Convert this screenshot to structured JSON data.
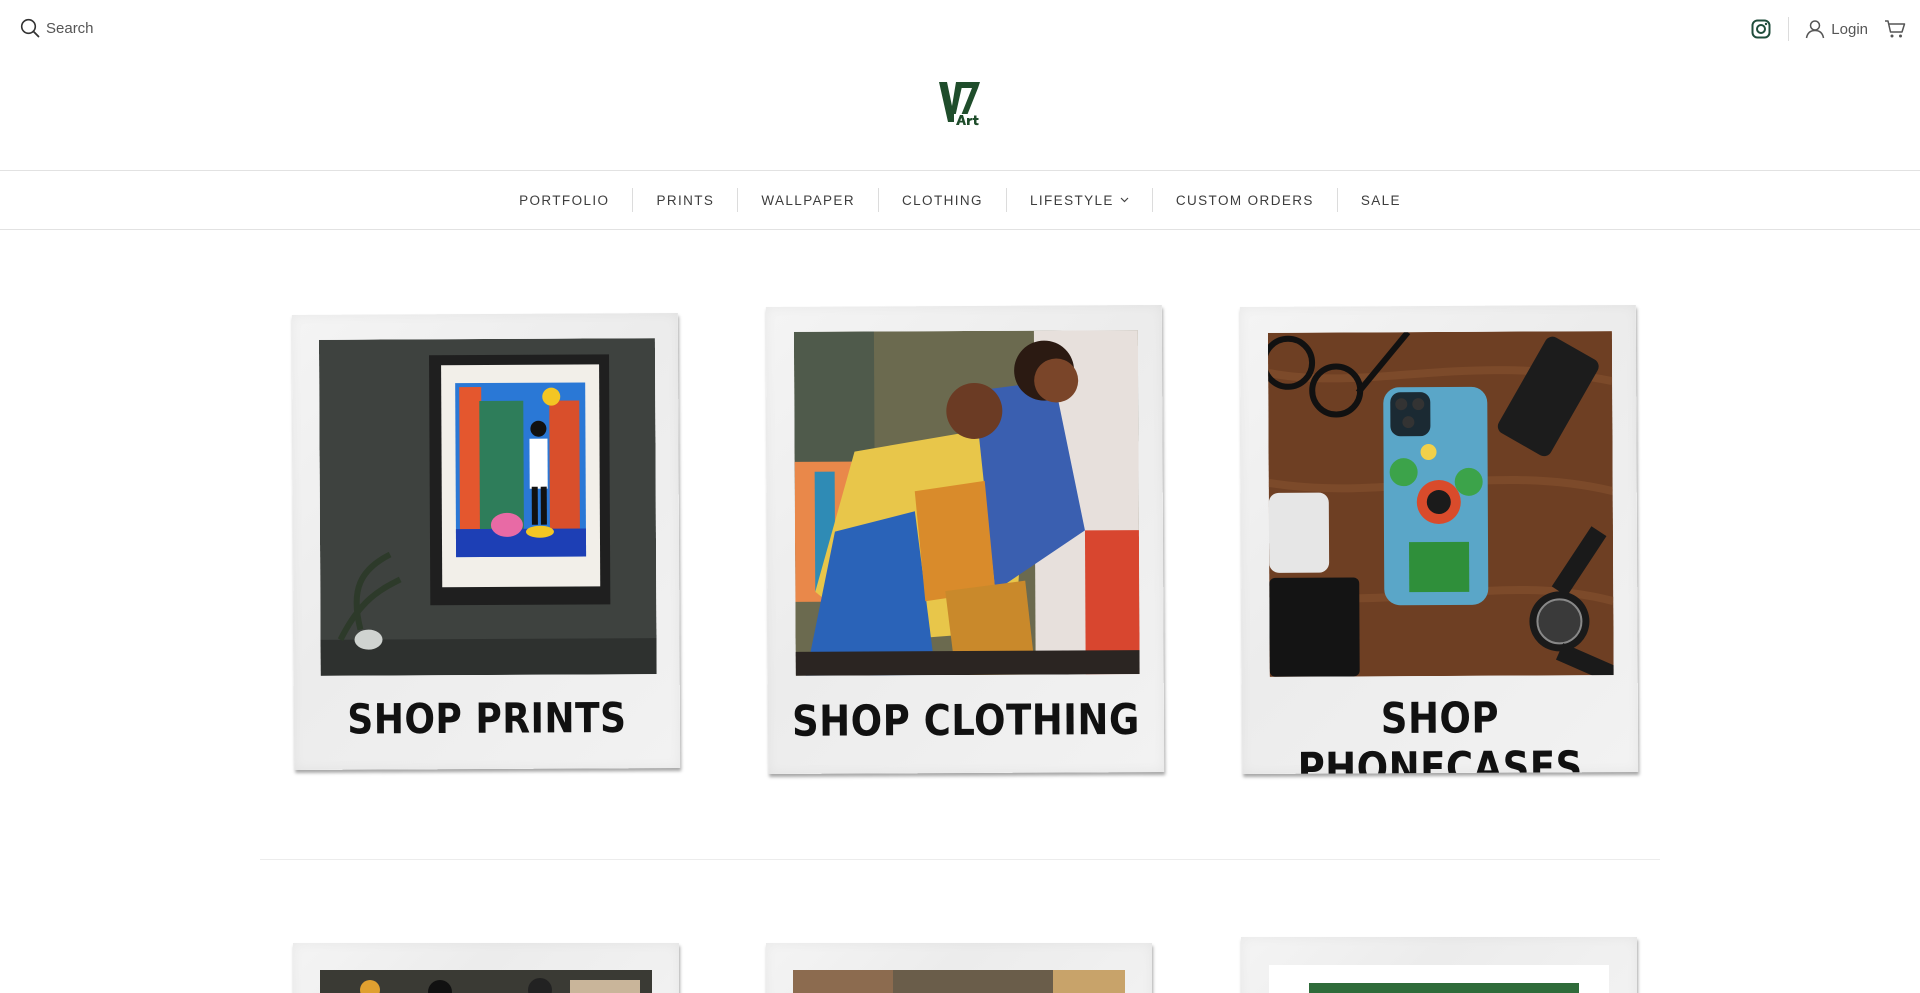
{
  "header": {
    "search_label": "Search",
    "login_label": "Login"
  },
  "nav": {
    "items": [
      {
        "label": "PORTFOLIO"
      },
      {
        "label": "PRINTS"
      },
      {
        "label": "WALLPAPER"
      },
      {
        "label": "CLOTHING"
      },
      {
        "label": "LIFESTYLE",
        "has_dropdown": true
      },
      {
        "label": "CUSTOM ORDERS"
      },
      {
        "label": "SALE"
      }
    ]
  },
  "cards": [
    {
      "caption": "SHOP PRINTS"
    },
    {
      "caption": "SHOP CLOTHING"
    },
    {
      "caption": "SHOP PHONECASES"
    }
  ],
  "colors": {
    "logo_green": "#1f4d2b",
    "instagram_green": "#1f4d3b",
    "text": "#3a3a3a"
  }
}
